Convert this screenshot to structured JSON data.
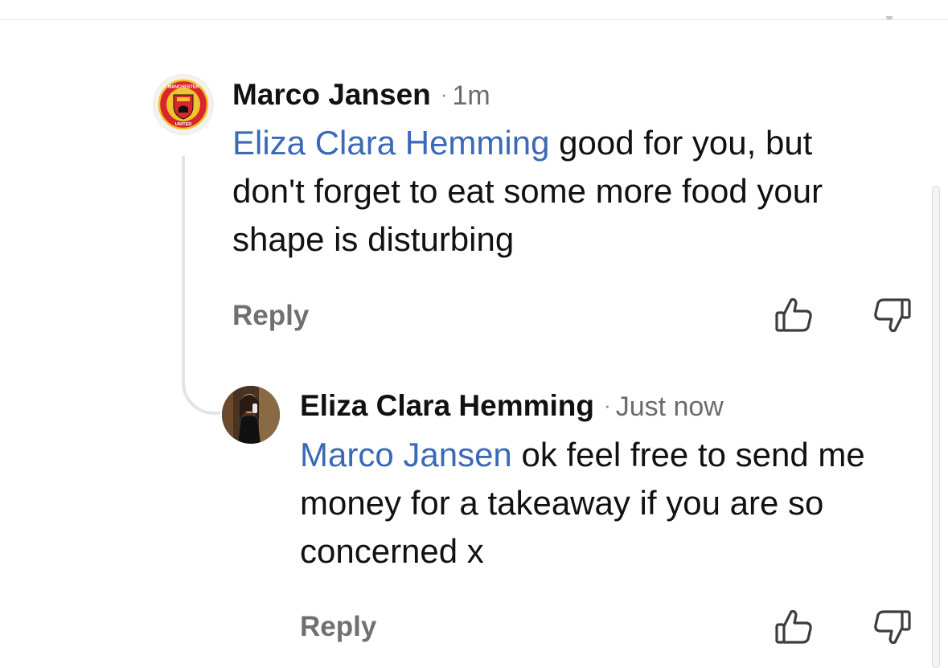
{
  "comments": [
    {
      "author": "Marco Jansen",
      "separator": "·",
      "time": "1m",
      "mention": "Eliza Clara Hemming",
      "text_line1_rest": " good for you, but",
      "text_line2": "don't forget to eat some more food your",
      "text_line3": "shape is disturbing",
      "reply_label": "Reply",
      "avatar_icon": "manchester-united-crest",
      "avatar_crest_text_top": "MANCHESTER",
      "avatar_crest_text_bottom": "UNITED"
    },
    {
      "author": "Eliza Clara Hemming",
      "separator": "·",
      "time": "Just now",
      "mention": "Marco Jansen",
      "text_line1_rest": " ok feel free to send me",
      "text_line2": "money for a takeaway if you are so",
      "text_line3": "concerned x",
      "reply_label": "Reply",
      "avatar_icon": "profile-photo"
    }
  ],
  "icons": {
    "like": "thumbs-up-icon",
    "dislike": "thumbs-down-icon"
  },
  "colors": {
    "mention": "#3b69b7",
    "muted": "#707070",
    "thread_line": "#e4e4e6"
  }
}
